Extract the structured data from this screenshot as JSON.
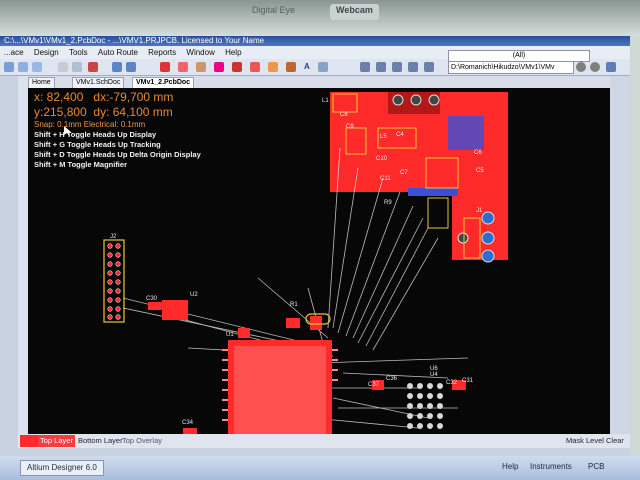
{
  "bezel": {
    "label_left": "Digital Eye",
    "label_right": "Webcam"
  },
  "window": {
    "title": "C:\\...\\VMv1\\VMv1_2.PcbDoc - ...\\VMV1.PRJPCB. Licensed to Your Name"
  },
  "menu": [
    "...ace",
    "Design",
    "Tools",
    "Auto Route",
    "Reports",
    "Window",
    "Help"
  ],
  "toolbar": {
    "path": "D:\\Romanich\\Hikudzo\\VMv1\\VMv",
    "filter": "(All)"
  },
  "tabs": [
    "Home",
    "VMv1.SchDoc",
    "VMv1_2.PcbDoc"
  ],
  "hud": {
    "coord_x": "x: 82,400",
    "coord_dx": "dx:-79,700 mm",
    "coord_y": "y:215,800",
    "coord_dy": "dy: 64,100 mm",
    "snap": "Snap: 0.1mm Electrical: 0.1mm",
    "shortcuts": [
      "Shift + H  Toggle Heads Up Display",
      "Shift + G  Toggle Heads Up Tracking",
      "Shift + D  Toggle Heads Up Delta Origin Display",
      "Shift + M  Toggle Magnifier"
    ]
  },
  "designators": [
    "L1",
    "C8",
    "C9",
    "L5",
    "C4",
    "C10",
    "C6",
    "C11",
    "C7",
    "C5",
    "R9",
    "J1",
    "J2",
    "C30",
    "U2",
    "R1",
    "U1",
    "C34",
    "C36",
    "C37",
    "U4",
    "C32",
    "C31",
    "U6"
  ],
  "layers": {
    "top": "Top Layer",
    "bottom": "Bottom Layer",
    "overlay": "Top Overlay",
    "mask_level": "Mask Level",
    "clear": "Clear"
  },
  "taskbar": {
    "app": "Altium Designer 6.0",
    "helpers": [
      "Help",
      "Instruments",
      "PCB"
    ]
  },
  "colors": {
    "canvas": "#070707",
    "copper_top": "#ff2a2a",
    "silkscreen": "#e8c53a",
    "pads": "#cfcfcf",
    "hud": "#e8892f"
  }
}
